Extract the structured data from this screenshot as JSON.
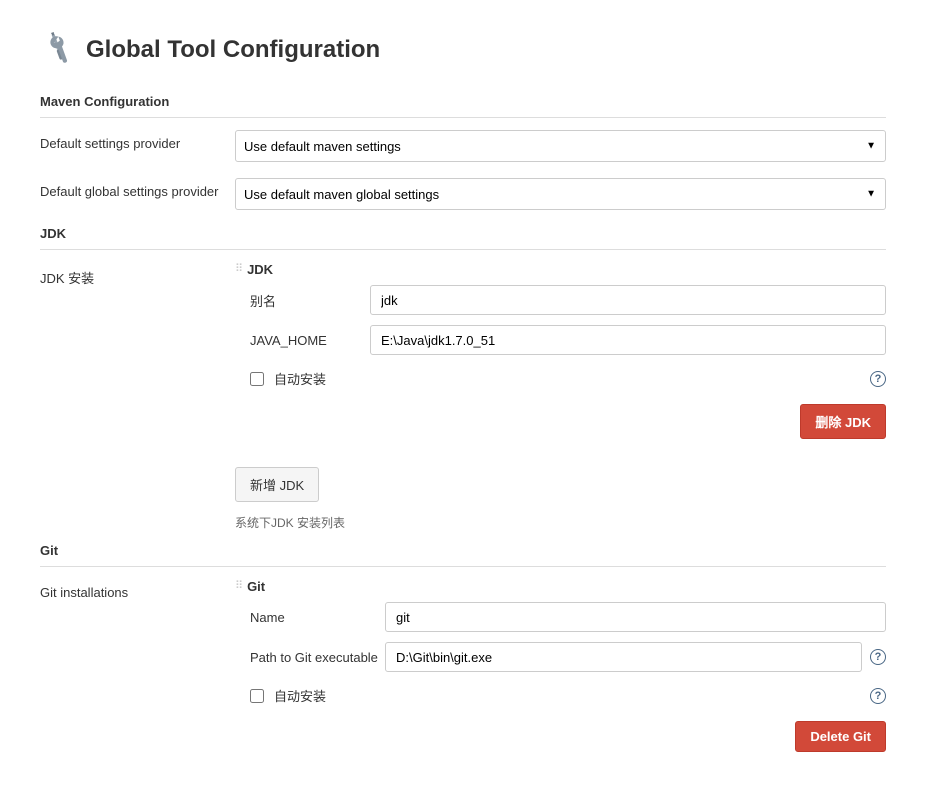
{
  "header": {
    "title": "Global Tool Configuration"
  },
  "maven": {
    "section_title": "Maven Configuration",
    "default_settings_label": "Default settings provider",
    "default_settings_value": "Use default maven settings",
    "default_global_label": "Default global settings provider",
    "default_global_value": "Use default maven global settings"
  },
  "jdk": {
    "section_title": "JDK",
    "install_label": "JDK 安装",
    "sub_header": "JDK",
    "alias_label": "别名",
    "alias_value": "jdk",
    "java_home_label": "JAVA_HOME",
    "java_home_value": "E:\\Java\\jdk1.7.0_51",
    "auto_install_label": "自动安装",
    "delete_button": "删除 JDK",
    "add_button": "新增 JDK",
    "list_hint": "系统下JDK 安装列表"
  },
  "git": {
    "section_title": "Git",
    "installations_label": "Git installations",
    "sub_header": "Git",
    "name_label": "Name",
    "name_value": "git",
    "path_label": "Path to Git executable",
    "path_value": "D:\\Git\\bin\\git.exe",
    "auto_install_label": "自动安装",
    "delete_button": "Delete Git"
  }
}
